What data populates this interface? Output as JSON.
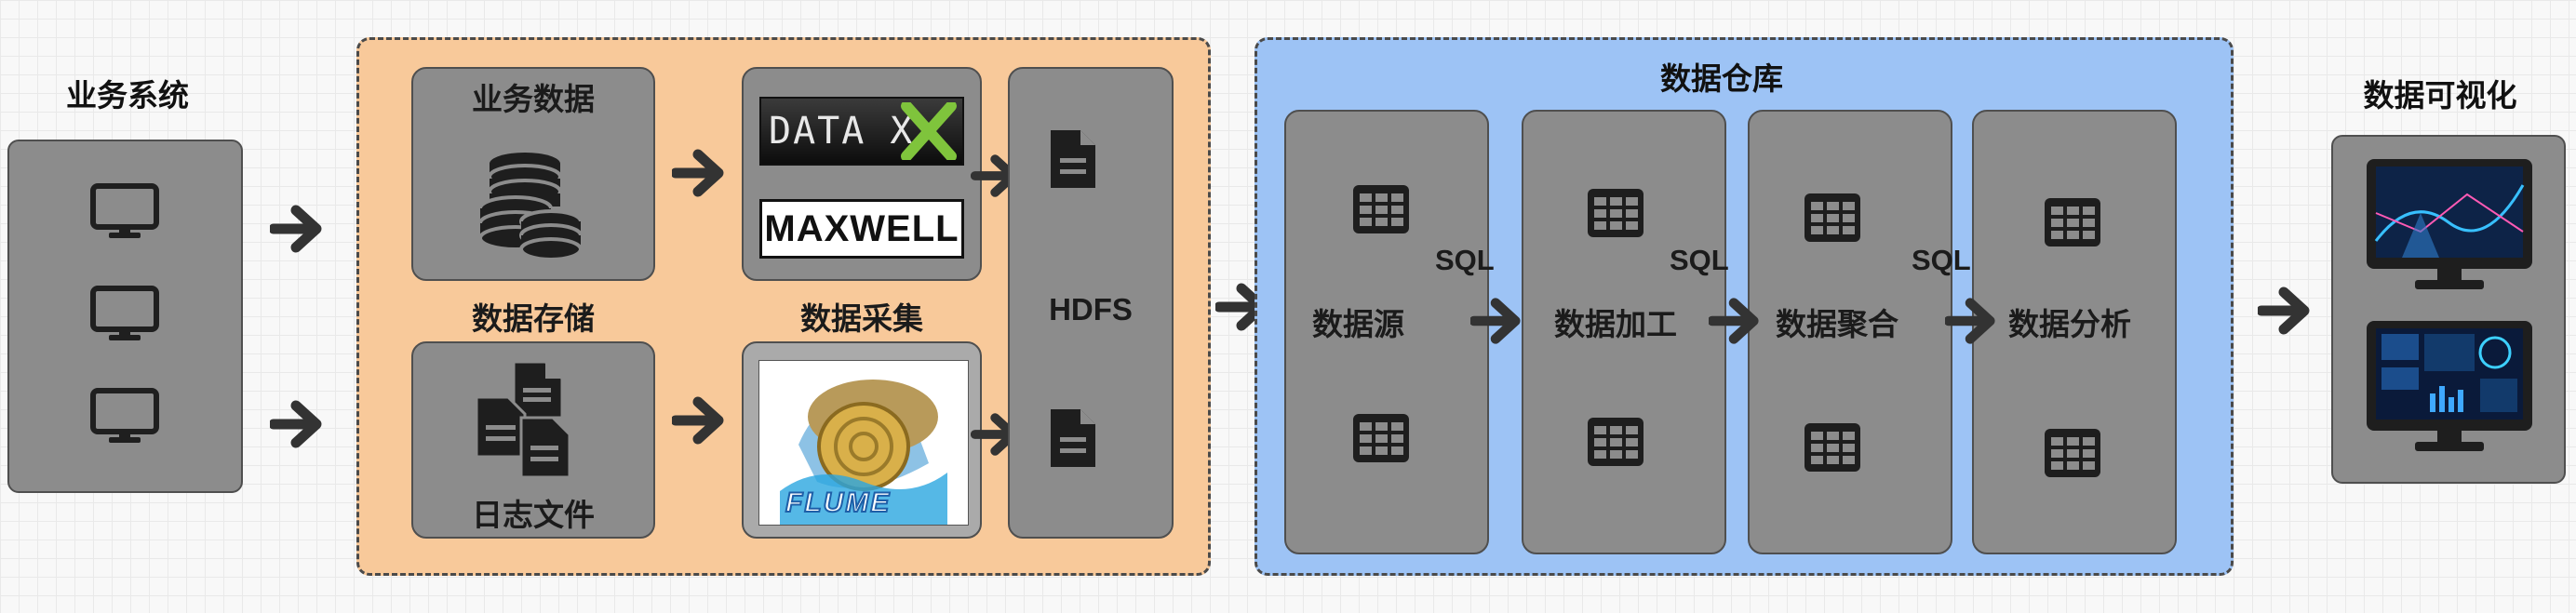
{
  "biz_system": {
    "title": "业务系统"
  },
  "collection": {
    "biz_data": "业务数据",
    "storage": "数据存储",
    "gather": "数据采集",
    "log_files": "日志文件",
    "hdfs": "HDFS",
    "logo_datax": "DATA X",
    "logo_maxwell": "MAXWELL",
    "logo_flume": "FLUME"
  },
  "warehouse": {
    "title": "数据仓库",
    "stages": [
      {
        "label": "数据源"
      },
      {
        "label": "数据加工"
      },
      {
        "label": "数据聚合"
      },
      {
        "label": "数据分析"
      }
    ],
    "sql_labels": [
      "SQL",
      "SQL",
      "SQL"
    ]
  },
  "viz": {
    "title": "数据可视化"
  },
  "colors": {
    "collection_bg": "#f8c99a",
    "warehouse_bg": "#9dc3f5",
    "box_gray": "#8c8c8c",
    "arrow": "#333333"
  }
}
